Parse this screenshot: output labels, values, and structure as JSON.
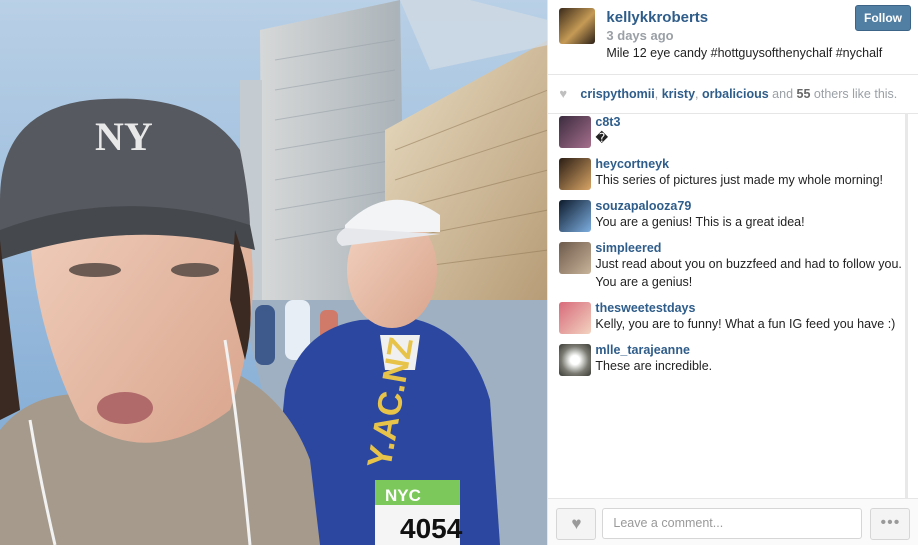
{
  "post": {
    "username": "kellykkroberts",
    "time": "3 days ago",
    "caption": "Mile 12 eye candy #hottguysofthenychalf #nychalf",
    "follow_label": "Follow"
  },
  "likes": {
    "names": [
      "crispythomii",
      "kristy",
      "orbalicious"
    ],
    "and": "and",
    "count": "55",
    "suffix": "others like this."
  },
  "comments": [
    {
      "user": "c8t3",
      "text": "�"
    },
    {
      "user": "heycortneyk",
      "text": "This series of pictures just made my whole morning!"
    },
    {
      "user": "souzapalooza79",
      "text": "You are a genius! This is a great idea!"
    },
    {
      "user": "simpleered",
      "text": "Just read about you on buzzfeed and had to follow you. You are a genius!"
    },
    {
      "user": "thesweetestdays",
      "text": "Kelly, you are to funny! What a fun IG feed you have :)"
    },
    {
      "user": "mlle_tarajeanne",
      "text": "These are incredible."
    }
  ],
  "photo_text": {
    "cap_logo": "NY",
    "shirt_text": "Y.AC.NZ",
    "bib_top": "NYC",
    "bib_number": "4054"
  },
  "footer": {
    "comment_placeholder": "Leave a comment...",
    "heart_icon": "heart-icon",
    "more_icon": "more-icon"
  }
}
